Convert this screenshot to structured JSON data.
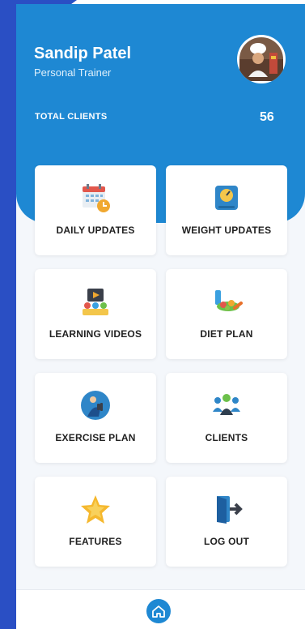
{
  "profile": {
    "name": "Sandip Patel",
    "role": "Personal Trainer",
    "avatar_icon": "chef-avatar-photo"
  },
  "stats": {
    "total_clients_label": "TOTAL CLIENTS",
    "total_clients_value": "56"
  },
  "menu": [
    {
      "label": "DAILY UPDATES",
      "icon": "calendar-clock-icon"
    },
    {
      "label": "WEIGHT UPDATES",
      "icon": "scale-icon"
    },
    {
      "label": "LEARNING VIDEOS",
      "icon": "video-class-icon"
    },
    {
      "label": "DIET PLAN",
      "icon": "healthy-food-icon"
    },
    {
      "label": "EXERCISE PLAN",
      "icon": "dumbbell-person-icon"
    },
    {
      "label": "CLIENTS",
      "icon": "group-people-icon"
    },
    {
      "label": "FEATURES",
      "icon": "star-icon"
    },
    {
      "label": "LOG OUT",
      "icon": "logout-door-icon"
    }
  ],
  "nav": {
    "home_icon": "home-icon"
  },
  "colors": {
    "primary": "#1e88d3",
    "backdrop": "#2a4fc4",
    "surface": "#f4f7fb"
  }
}
